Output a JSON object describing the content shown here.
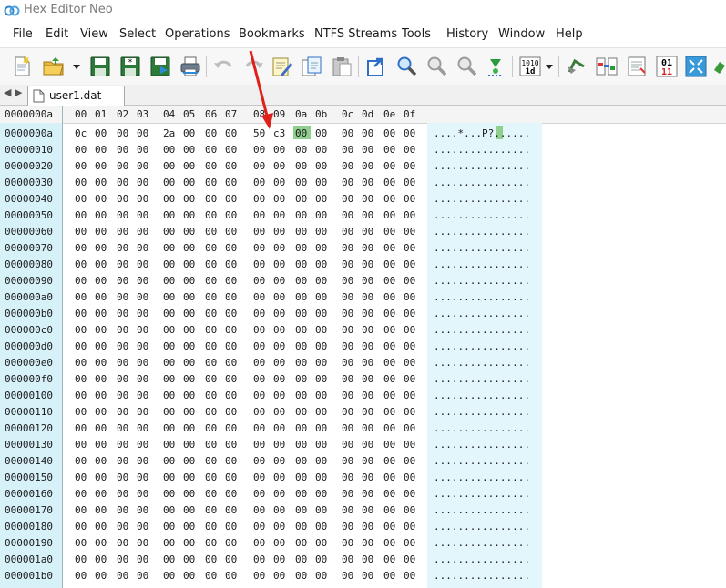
{
  "window": {
    "title": "Hex Editor Neo"
  },
  "menu": [
    "File",
    "Edit",
    "View",
    "Select",
    "Operations",
    "Bookmarks",
    "NTFS Streams",
    "Tools",
    "History",
    "Window",
    "Help"
  ],
  "tab": {
    "label": "user1.dat"
  },
  "header": {
    "offset": "0000000a",
    "columns": [
      "00",
      "01",
      "02",
      "03",
      "04",
      "05",
      "06",
      "07",
      "08",
      "09",
      "0a",
      "0b",
      "0c",
      "0d",
      "0e",
      "0f"
    ]
  },
  "rows": [
    {
      "offset": "0000000a",
      "bytes": [
        "0c",
        "00",
        "00",
        "00",
        "2a",
        "00",
        "00",
        "00",
        "50",
        "c3",
        "00",
        "00",
        "00",
        "00",
        "00",
        "00"
      ],
      "ascii": "....*...P?......"
    },
    {
      "offset": "00000010",
      "bytes": [
        "00",
        "00",
        "00",
        "00",
        "00",
        "00",
        "00",
        "00",
        "00",
        "00",
        "00",
        "00",
        "00",
        "00",
        "00",
        "00"
      ],
      "ascii": "................"
    },
    {
      "offset": "00000020",
      "bytes": [
        "00",
        "00",
        "00",
        "00",
        "00",
        "00",
        "00",
        "00",
        "00",
        "00",
        "00",
        "00",
        "00",
        "00",
        "00",
        "00"
      ],
      "ascii": "................"
    },
    {
      "offset": "00000030",
      "bytes": [
        "00",
        "00",
        "00",
        "00",
        "00",
        "00",
        "00",
        "00",
        "00",
        "00",
        "00",
        "00",
        "00",
        "00",
        "00",
        "00"
      ],
      "ascii": "................"
    },
    {
      "offset": "00000040",
      "bytes": [
        "00",
        "00",
        "00",
        "00",
        "00",
        "00",
        "00",
        "00",
        "00",
        "00",
        "00",
        "00",
        "00",
        "00",
        "00",
        "00"
      ],
      "ascii": "................"
    },
    {
      "offset": "00000050",
      "bytes": [
        "00",
        "00",
        "00",
        "00",
        "00",
        "00",
        "00",
        "00",
        "00",
        "00",
        "00",
        "00",
        "00",
        "00",
        "00",
        "00"
      ],
      "ascii": "................"
    },
    {
      "offset": "00000060",
      "bytes": [
        "00",
        "00",
        "00",
        "00",
        "00",
        "00",
        "00",
        "00",
        "00",
        "00",
        "00",
        "00",
        "00",
        "00",
        "00",
        "00"
      ],
      "ascii": "................"
    },
    {
      "offset": "00000070",
      "bytes": [
        "00",
        "00",
        "00",
        "00",
        "00",
        "00",
        "00",
        "00",
        "00",
        "00",
        "00",
        "00",
        "00",
        "00",
        "00",
        "00"
      ],
      "ascii": "................"
    },
    {
      "offset": "00000080",
      "bytes": [
        "00",
        "00",
        "00",
        "00",
        "00",
        "00",
        "00",
        "00",
        "00",
        "00",
        "00",
        "00",
        "00",
        "00",
        "00",
        "00"
      ],
      "ascii": "................"
    },
    {
      "offset": "00000090",
      "bytes": [
        "00",
        "00",
        "00",
        "00",
        "00",
        "00",
        "00",
        "00",
        "00",
        "00",
        "00",
        "00",
        "00",
        "00",
        "00",
        "00"
      ],
      "ascii": "................"
    },
    {
      "offset": "000000a0",
      "bytes": [
        "00",
        "00",
        "00",
        "00",
        "00",
        "00",
        "00",
        "00",
        "00",
        "00",
        "00",
        "00",
        "00",
        "00",
        "00",
        "00"
      ],
      "ascii": "................"
    },
    {
      "offset": "000000b0",
      "bytes": [
        "00",
        "00",
        "00",
        "00",
        "00",
        "00",
        "00",
        "00",
        "00",
        "00",
        "00",
        "00",
        "00",
        "00",
        "00",
        "00"
      ],
      "ascii": "................"
    },
    {
      "offset": "000000c0",
      "bytes": [
        "00",
        "00",
        "00",
        "00",
        "00",
        "00",
        "00",
        "00",
        "00",
        "00",
        "00",
        "00",
        "00",
        "00",
        "00",
        "00"
      ],
      "ascii": "................"
    },
    {
      "offset": "000000d0",
      "bytes": [
        "00",
        "00",
        "00",
        "00",
        "00",
        "00",
        "00",
        "00",
        "00",
        "00",
        "00",
        "00",
        "00",
        "00",
        "00",
        "00"
      ],
      "ascii": "................"
    },
    {
      "offset": "000000e0",
      "bytes": [
        "00",
        "00",
        "00",
        "00",
        "00",
        "00",
        "00",
        "00",
        "00",
        "00",
        "00",
        "00",
        "00",
        "00",
        "00",
        "00"
      ],
      "ascii": "................"
    },
    {
      "offset": "000000f0",
      "bytes": [
        "00",
        "00",
        "00",
        "00",
        "00",
        "00",
        "00",
        "00",
        "00",
        "00",
        "00",
        "00",
        "00",
        "00",
        "00",
        "00"
      ],
      "ascii": "................"
    },
    {
      "offset": "00000100",
      "bytes": [
        "00",
        "00",
        "00",
        "00",
        "00",
        "00",
        "00",
        "00",
        "00",
        "00",
        "00",
        "00",
        "00",
        "00",
        "00",
        "00"
      ],
      "ascii": "................"
    },
    {
      "offset": "00000110",
      "bytes": [
        "00",
        "00",
        "00",
        "00",
        "00",
        "00",
        "00",
        "00",
        "00",
        "00",
        "00",
        "00",
        "00",
        "00",
        "00",
        "00"
      ],
      "ascii": "................"
    },
    {
      "offset": "00000120",
      "bytes": [
        "00",
        "00",
        "00",
        "00",
        "00",
        "00",
        "00",
        "00",
        "00",
        "00",
        "00",
        "00",
        "00",
        "00",
        "00",
        "00"
      ],
      "ascii": "................"
    },
    {
      "offset": "00000130",
      "bytes": [
        "00",
        "00",
        "00",
        "00",
        "00",
        "00",
        "00",
        "00",
        "00",
        "00",
        "00",
        "00",
        "00",
        "00",
        "00",
        "00"
      ],
      "ascii": "................"
    },
    {
      "offset": "00000140",
      "bytes": [
        "00",
        "00",
        "00",
        "00",
        "00",
        "00",
        "00",
        "00",
        "00",
        "00",
        "00",
        "00",
        "00",
        "00",
        "00",
        "00"
      ],
      "ascii": "................"
    },
    {
      "offset": "00000150",
      "bytes": [
        "00",
        "00",
        "00",
        "00",
        "00",
        "00",
        "00",
        "00",
        "00",
        "00",
        "00",
        "00",
        "00",
        "00",
        "00",
        "00"
      ],
      "ascii": "................"
    },
    {
      "offset": "00000160",
      "bytes": [
        "00",
        "00",
        "00",
        "00",
        "00",
        "00",
        "00",
        "00",
        "00",
        "00",
        "00",
        "00",
        "00",
        "00",
        "00",
        "00"
      ],
      "ascii": "................"
    },
    {
      "offset": "00000170",
      "bytes": [
        "00",
        "00",
        "00",
        "00",
        "00",
        "00",
        "00",
        "00",
        "00",
        "00",
        "00",
        "00",
        "00",
        "00",
        "00",
        "00"
      ],
      "ascii": "................"
    },
    {
      "offset": "00000180",
      "bytes": [
        "00",
        "00",
        "00",
        "00",
        "00",
        "00",
        "00",
        "00",
        "00",
        "00",
        "00",
        "00",
        "00",
        "00",
        "00",
        "00"
      ],
      "ascii": "................"
    },
    {
      "offset": "00000190",
      "bytes": [
        "00",
        "00",
        "00",
        "00",
        "00",
        "00",
        "00",
        "00",
        "00",
        "00",
        "00",
        "00",
        "00",
        "00",
        "00",
        "00"
      ],
      "ascii": "................"
    },
    {
      "offset": "000001a0",
      "bytes": [
        "00",
        "00",
        "00",
        "00",
        "00",
        "00",
        "00",
        "00",
        "00",
        "00",
        "00",
        "00",
        "00",
        "00",
        "00",
        "00"
      ],
      "ascii": "................"
    },
    {
      "offset": "000001b0",
      "bytes": [
        "00",
        "00",
        "00",
        "00",
        "00",
        "00",
        "00",
        "00",
        "00",
        "00",
        "00",
        "00",
        "00",
        "00",
        "00",
        "00"
      ],
      "ascii": "................"
    }
  ],
  "selection": {
    "byte_index": 10,
    "row": 0
  },
  "colors": {
    "offset_bg": "#d7f1f9",
    "ascii_bg": "#e3f6fb",
    "selection": "#8fd08f",
    "annotation_arrow": "#e0211b"
  },
  "toolbar_icons": [
    "new-file-icon",
    "open-folder-icon",
    "dropdown-arrow-icon",
    "save-icon",
    "save-all-icon",
    "save-as-icon",
    "print-icon",
    "undo-icon",
    "redo-icon",
    "edit-icon",
    "copy-icon",
    "paste-icon",
    "go-to-icon",
    "find-icon",
    "find-next-icon",
    "find-previous-icon",
    "bookmark-icon",
    "binary-view-icon",
    "rollback-icon",
    "compare-icon",
    "properties-icon",
    "bits-icon",
    "fullscreen-icon",
    "more-icon"
  ]
}
